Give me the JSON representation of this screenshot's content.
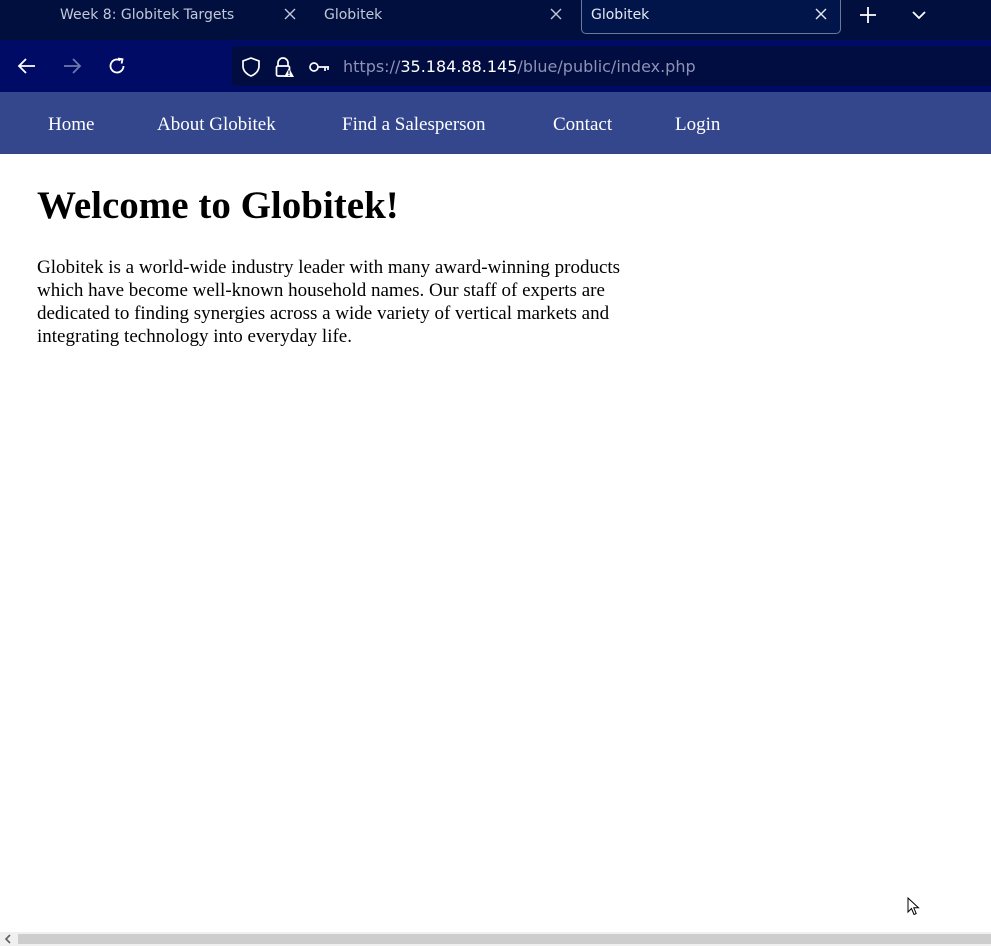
{
  "browser": {
    "tabs": [
      {
        "title": "Week 8: Globitek Targets",
        "active": false
      },
      {
        "title": "Globitek",
        "active": false
      },
      {
        "title": "Globitek",
        "active": true
      }
    ],
    "url": {
      "scheme": "https://",
      "host": "35.184.88.145",
      "path": "/blue/public/index.php"
    },
    "colors": {
      "tabbar": "#000f3d",
      "toolbar": "#000b66",
      "urlbar": "#010c40"
    }
  },
  "site": {
    "nav": {
      "home": "Home",
      "about": "About Globitek",
      "find_salesperson": "Find a Salesperson",
      "contact": "Contact",
      "login": "Login"
    },
    "nav_color": "#35478c",
    "heading": "Welcome to Globitek!",
    "body_text": "Globitek is a world-wide industry leader with many award-winning products which have become well-known household names. Our staff of experts are dedicated to finding synergies across a wide variety of vertical markets and integrating technology into everyday life."
  }
}
